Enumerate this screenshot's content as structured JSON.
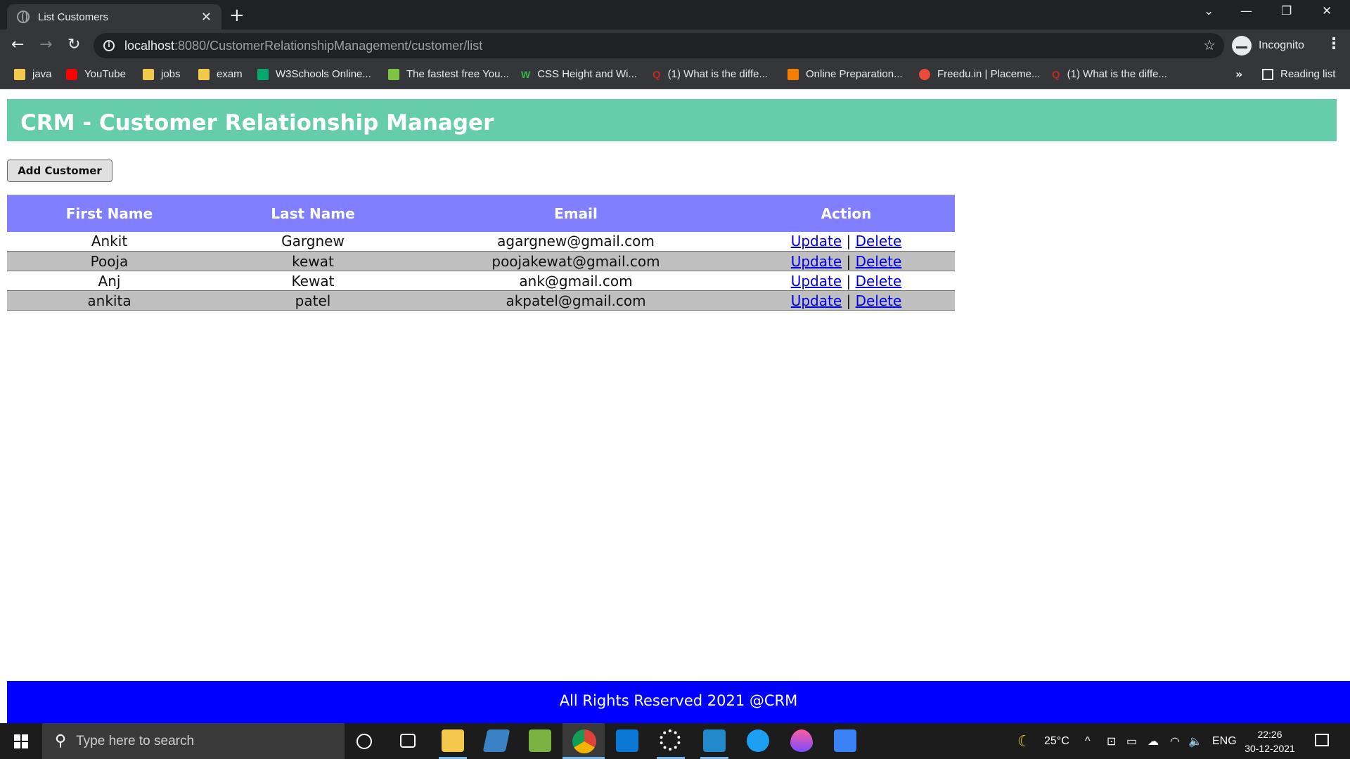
{
  "browser": {
    "tab_title": "List Customers",
    "tab_close": "✕",
    "new_tab": "+",
    "url_host": "localhost",
    "url_path": ":8080/CustomerRelationshipManagement/customer/list",
    "profile_label": "Incognito",
    "bookmarks": [
      {
        "label": "java",
        "icon": "folder-icon"
      },
      {
        "label": "YouTube",
        "icon": "youtube-icon"
      },
      {
        "label": "jobs",
        "icon": "folder-icon"
      },
      {
        "label": "exam",
        "icon": "folder-icon"
      },
      {
        "label": "W3Schools Online...",
        "icon": "w3schools-icon"
      },
      {
        "label": "The fastest free You...",
        "icon": "download-icon"
      },
      {
        "label": "CSS Height and Wi...",
        "icon": "w3-icon"
      },
      {
        "label": "(1) What is the diffe...",
        "icon": "quora-icon"
      },
      {
        "label": "Online Preparation...",
        "icon": "blogger-icon"
      },
      {
        "label": "Freedu.in | Placeme...",
        "icon": "freedu-icon"
      },
      {
        "label": "(1) What is the diffe...",
        "icon": "quora-icon"
      }
    ],
    "bookmarks_more": "»",
    "reading_list": "Reading list"
  },
  "page": {
    "header_title": "CRM - Customer Relationship Manager",
    "add_button": "Add Customer",
    "table": {
      "headers": [
        "First Name",
        "Last Name",
        "Email",
        "Action"
      ],
      "rows": [
        {
          "first": "Ankit",
          "last": "Gargnew",
          "email": "agargnew@gmail.com"
        },
        {
          "first": "Pooja",
          "last": "kewat",
          "email": "poojakewat@gmail.com"
        },
        {
          "first": "Anj",
          "last": "Kewat",
          "email": "ank@gmail.com"
        },
        {
          "first": "ankita",
          "last": "patel",
          "email": "akpatel@gmail.com"
        }
      ],
      "update_label": "Update",
      "separator": "|",
      "delete_label": "Delete"
    },
    "footer": "All Rights Reserved 2021 @CRM"
  },
  "taskbar": {
    "search_placeholder": "Type here to search",
    "weather": "25°C",
    "language": "ENG",
    "time": "22:26",
    "date": "30-12-2021"
  }
}
